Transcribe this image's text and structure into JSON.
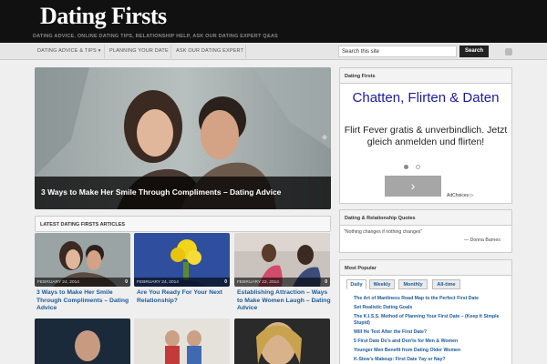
{
  "site": {
    "logo": "Dating Firsts",
    "tagline": "DATING ADVICE, ONLINE DATING TIPS, RELATIONSHIP HELP, ASK OUR DATING EXPERT Q&AS"
  },
  "nav": {
    "items": [
      "DATING ADVICE & TIPS ▾",
      "PLANNING YOUR DATE",
      "ASK OUR DATING EXPERT"
    ],
    "search_placeholder": "Search this site",
    "search_button": "Search"
  },
  "hero": {
    "title": "3 Ways to Make Her Smile Through Compliments – Dating Advice",
    "arrow": "◆"
  },
  "latest": {
    "heading": "LATEST DATING FIRSTS ARTICLES",
    "articles": [
      {
        "date": "FEBRUARY 24, 2014",
        "comments": "0",
        "title": "3 Ways to Make Her Smile Through Compliments – Dating Advice"
      },
      {
        "date": "FEBRUARY 24, 2014",
        "comments": "0",
        "title": "Are You Ready For Your Next Relationship?"
      },
      {
        "date": "FEBRUARY 22, 2014",
        "comments": "0",
        "title": "Establishing Attraction – Ways to Make Women Laugh – Dating Advice"
      }
    ]
  },
  "sidebar": {
    "ad_panel": {
      "heading": "Dating Firsts",
      "headline": "Chatten, Flirten & Daten",
      "body": "Flirt Fever gratis & unverbindlich. Jetzt gleich anmelden und flirten!",
      "button_glyph": "›",
      "adchoices": "AdChoices ▷"
    },
    "quotes": {
      "heading": "Dating & Relationship Quotes",
      "quote": "\"Nothing changes if nothing changes\"",
      "author": "— Donna Barnes"
    },
    "popular": {
      "heading": "Most Popular",
      "tabs": [
        "Daily",
        "Weekly",
        "Monthly",
        "All-time"
      ],
      "items": [
        "The Art of Manliness Road Map to the Perfect First Date",
        "Set Realistic Dating Goals",
        "The K.I.S.S. Method of Planning Your First Date – (Keep It Simple Stupid)",
        "Will He Text After the First Date?",
        "5 First Date Do's and Don'ts for Men & Women",
        "Younger Men Benefit from Dating Older Women",
        "K-Stew's Makeup: First Date Yay or Nay?"
      ]
    }
  }
}
